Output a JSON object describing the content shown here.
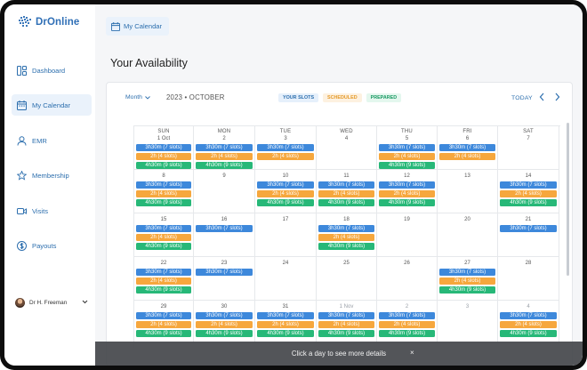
{
  "app": {
    "logo_text": "DrOnline"
  },
  "sidebar": {
    "items": [
      {
        "label": "Dashboard",
        "icon": "dashboard-icon",
        "active": false
      },
      {
        "label": "My Calendar",
        "icon": "calendar-icon",
        "active": true
      },
      {
        "label": "EMR",
        "icon": "user-icon",
        "active": false
      },
      {
        "label": "Membership",
        "icon": "star-icon",
        "active": false
      },
      {
        "label": "Visits",
        "icon": "video-icon",
        "active": false
      },
      {
        "label": "Payouts",
        "icon": "dollar-icon",
        "active": false
      }
    ],
    "user": {
      "name": "Dr H. Freeman",
      "menu_icon": "chevron-down-icon"
    }
  },
  "header": {
    "breadcrumb": "My Calendar",
    "page_title": "Your Availability"
  },
  "calendar": {
    "view_select": "Month",
    "current_month": "2023 • OCTOBER",
    "legend": {
      "your_slots": "YOUR SLOTS",
      "scheduled": "SCHEDULED",
      "prepared": "PREPARED"
    },
    "today_label": "TODAY",
    "prev_icon": "chevron-left-icon",
    "next_icon": "chevron-right-icon",
    "colors": {
      "your_slots": "#3d88db",
      "scheduled": "#f6a73d",
      "prepared": "#27b878"
    },
    "weekdays": [
      "SUN",
      "MON",
      "TUE",
      "WED",
      "THU",
      "FRI",
      "SAT"
    ],
    "weeks": [
      [
        {
          "day": "1 Oct",
          "slots": [
            "3h30m (7 slots)",
            "2h (4 slots)",
            "4h30m (9 slots)"
          ]
        },
        {
          "day": "2",
          "slots": [
            "3h30m (7 slots)",
            "2h (4 slots)",
            "4h30m (9 slots)"
          ]
        },
        {
          "day": "3",
          "slots": [
            "3h30m (7 slots)",
            "2h (4 slots)",
            null
          ]
        },
        {
          "day": "4",
          "slots": [
            null,
            null,
            null
          ]
        },
        {
          "day": "5",
          "slots": [
            "3h30m (7 slots)",
            "2h (4 slots)",
            "4h30m (9 slots)"
          ]
        },
        {
          "day": "6",
          "slots": [
            "3h30m (7 slots)",
            "2h (4 slots)",
            null
          ]
        },
        {
          "day": "7",
          "slots": [
            null,
            null,
            null
          ]
        }
      ],
      [
        {
          "day": "8",
          "slots": [
            "3h30m (7 slots)",
            "2h (4 slots)",
            "4h30m (9 slots)"
          ]
        },
        {
          "day": "9",
          "slots": [
            null,
            null,
            null
          ]
        },
        {
          "day": "10",
          "slots": [
            "3h30m (7 slots)",
            "2h (4 slots)",
            "4h30m (9 slots)"
          ]
        },
        {
          "day": "11",
          "slots": [
            "3h30m (7 slots)",
            "2h (4 slots)",
            "4h30m (9 slots)"
          ]
        },
        {
          "day": "12",
          "slots": [
            "3h30m (7 slots)",
            "2h (4 slots)",
            "4h30m (9 slots)"
          ]
        },
        {
          "day": "13",
          "slots": [
            null,
            null,
            null
          ]
        },
        {
          "day": "14",
          "slots": [
            "3h30m (7 slots)",
            "2h (4 slots)",
            "4h30m (9 slots)"
          ]
        }
      ],
      [
        {
          "day": "15",
          "slots": [
            "3h30m (7 slots)",
            "2h (4 slots)",
            "4h30m (9 slots)"
          ]
        },
        {
          "day": "16",
          "slots": [
            "3h30m (7 slots)",
            null,
            null
          ]
        },
        {
          "day": "17",
          "slots": [
            null,
            null,
            null
          ]
        },
        {
          "day": "18",
          "slots": [
            "3h30m (7 slots)",
            "2h (4 slots)",
            "4h30m (9 slots)"
          ]
        },
        {
          "day": "19",
          "slots": [
            null,
            null,
            null
          ]
        },
        {
          "day": "20",
          "slots": [
            null,
            null,
            null
          ]
        },
        {
          "day": "21",
          "slots": [
            "3h30m (7 slots)",
            null,
            null
          ]
        }
      ],
      [
        {
          "day": "22",
          "slots": [
            "3h30m (7 slots)",
            "2h (4 slots)",
            "4h30m (9 slots)"
          ]
        },
        {
          "day": "23",
          "slots": [
            "3h30m (7 slots)",
            null,
            null
          ]
        },
        {
          "day": "24",
          "slots": [
            null,
            null,
            null
          ]
        },
        {
          "day": "25",
          "slots": [
            null,
            null,
            null
          ]
        },
        {
          "day": "26",
          "slots": [
            null,
            null,
            null
          ]
        },
        {
          "day": "27",
          "slots": [
            "3h30m (7 slots)",
            "2h (4 slots)",
            "4h30m (9 slots)"
          ]
        },
        {
          "day": "28",
          "slots": [
            null,
            null,
            null
          ]
        }
      ],
      [
        {
          "day": "29",
          "slots": [
            "3h30m (7 slots)",
            "2h (4 slots)",
            "4h30m (9 slots)"
          ]
        },
        {
          "day": "30",
          "slots": [
            "3h30m (7 slots)",
            "2h (4 slots)",
            "4h30m (9 slots)"
          ]
        },
        {
          "day": "31",
          "slots": [
            "3h30m (7 slots)",
            "2h (4 slots)",
            "4h30m (9 slots)"
          ]
        },
        {
          "day": "1 Nov",
          "muted": true,
          "slots": [
            "3h30m (7 slots)",
            "2h (4 slots)",
            "4h30m (9 slots)"
          ]
        },
        {
          "day": "2",
          "muted": true,
          "slots": [
            "3h30m (7 slots)",
            "2h (4 slots)",
            "4h30m (9 slots)"
          ]
        },
        {
          "day": "3",
          "muted": true,
          "slots": [
            null,
            null,
            null
          ]
        },
        {
          "day": "4",
          "muted": true,
          "slots": [
            "3h30m (7 slots)",
            "2h (4 slots)",
            "4h30m (9 slots)"
          ]
        }
      ]
    ]
  },
  "toast": {
    "message": "Click a day to see more details",
    "close_icon": "close-icon",
    "close_glyph": "×"
  }
}
